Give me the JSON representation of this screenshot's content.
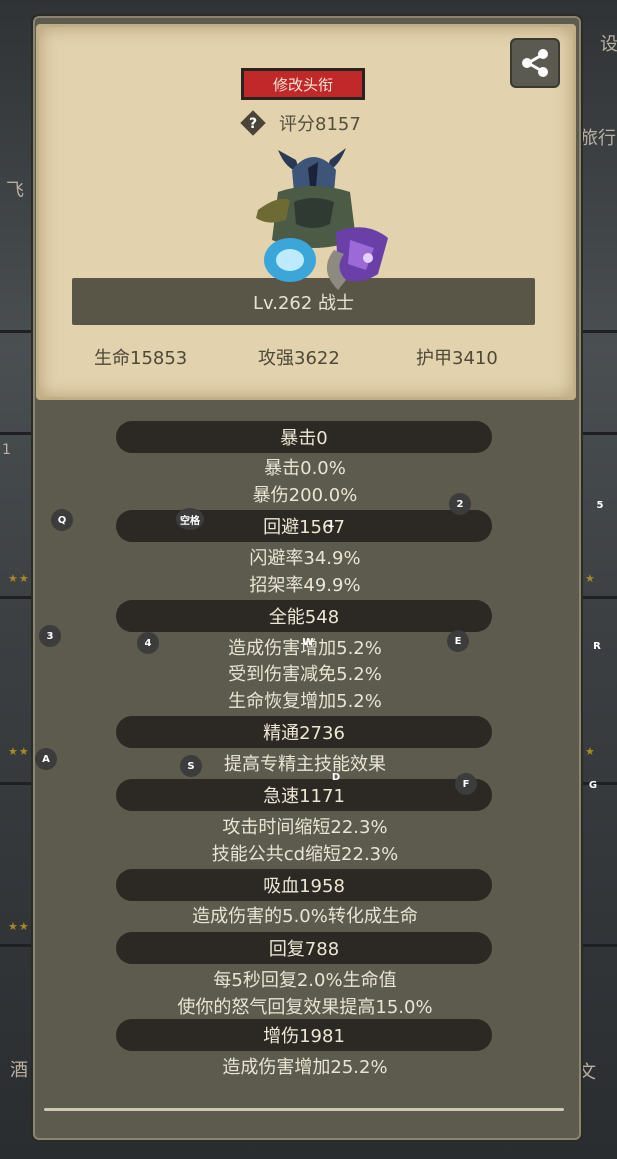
{
  "background": {
    "left_texts": [
      "飞",
      "酒"
    ],
    "right_texts": [
      "设",
      "旅行",
      "文"
    ],
    "left_numbers": [
      "1"
    ]
  },
  "card": {
    "title_button": "修改头衔",
    "score": "评分8157",
    "level_text": "Lv.262 战士",
    "base_stats": [
      "生命15853",
      "攻强3622",
      "护甲3410"
    ]
  },
  "sections": [
    {
      "banner": "暴击0",
      "lines": [
        "暴击0.0%",
        "暴伤200.0%"
      ]
    },
    {
      "banner": "回避1567",
      "lines": [
        "闪避率34.9%",
        "招架率49.9%"
      ]
    },
    {
      "banner": "全能548",
      "lines": [
        "造成伤害增加5.2%",
        "受到伤害减免5.2%",
        "生命恢复增加5.2%"
      ]
    },
    {
      "banner": "精通2736",
      "lines": [
        "提高专精主技能效果"
      ]
    },
    {
      "banner": "急速1171",
      "lines": [
        "攻击时间缩短22.3%",
        "技能公共cd缩短22.3%"
      ]
    },
    {
      "banner": "吸血1958",
      "lines": [
        "造成伤害的5.0%转化成生命"
      ]
    },
    {
      "banner": "回复788",
      "lines": [
        "每5秒回复2.0%生命值",
        "使你的怒气回复效果提高15.0%"
      ]
    },
    {
      "banner": "增伤1981",
      "lines": [
        "造成伤害增加25.2%"
      ]
    }
  ],
  "key_hints": [
    "Q",
    "空格",
    "1",
    "2",
    "5",
    "3",
    "4",
    "W",
    "E",
    "R",
    "A",
    "S",
    "D",
    "F",
    "G"
  ],
  "colors": {
    "accent_red": "#c1282a",
    "parchment": "#e2d2ae",
    "panel": "#5c5b4e",
    "banner": "#2c2823"
  }
}
